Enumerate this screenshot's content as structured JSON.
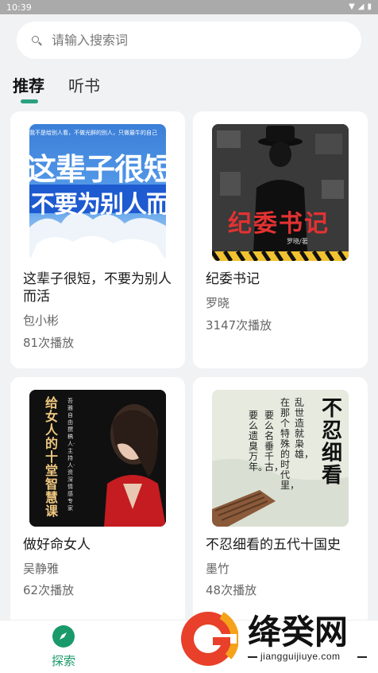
{
  "status_bar": {
    "time": "10:39"
  },
  "search": {
    "placeholder": "请输入搜索词"
  },
  "tabs": [
    {
      "label": "推荐",
      "active": true
    },
    {
      "label": "听书",
      "active": false
    }
  ],
  "books": [
    {
      "title": "这辈子很短，不要为别人而活",
      "author": "包小彬",
      "plays": "81次播放",
      "cover": {
        "top_text": "我不是给别人看，不做光鲜的别人，只做最牛的自己",
        "line1": "这辈子很短",
        "line2": "不要为别人而活"
      }
    },
    {
      "title": "纪委书记",
      "author": "罗晓",
      "plays": "3147次播放",
      "cover": {
        "main_text": "纪委书记",
        "byline": "罗晓/著"
      }
    },
    {
      "title": "做好命女人",
      "author": "吴静雅",
      "plays": "62次播放",
      "cover": {
        "vertical_text": "给女人的十堂智慧课",
        "side_text": "吾雅 自由撰稿人·主持人·资深情感专家"
      }
    },
    {
      "title": "不忍细看的五代十国史",
      "author": "墨竹",
      "plays": "48次播放",
      "cover": {
        "big_text": "不忍细看",
        "poem": [
          "乱世造就枭雄，",
          "在那个特殊的时代里，",
          "要么名垂千古，",
          "要么遗臭万年。"
        ]
      }
    }
  ],
  "bottom_nav": [
    {
      "label": "探索",
      "icon": "compass-icon",
      "active": true
    }
  ],
  "watermark": {
    "brand": "绛癸网",
    "url": "jiangguijiuye.com"
  },
  "colors": {
    "accent": "#1a9a6a",
    "tab_indicator": "#2aa080"
  }
}
